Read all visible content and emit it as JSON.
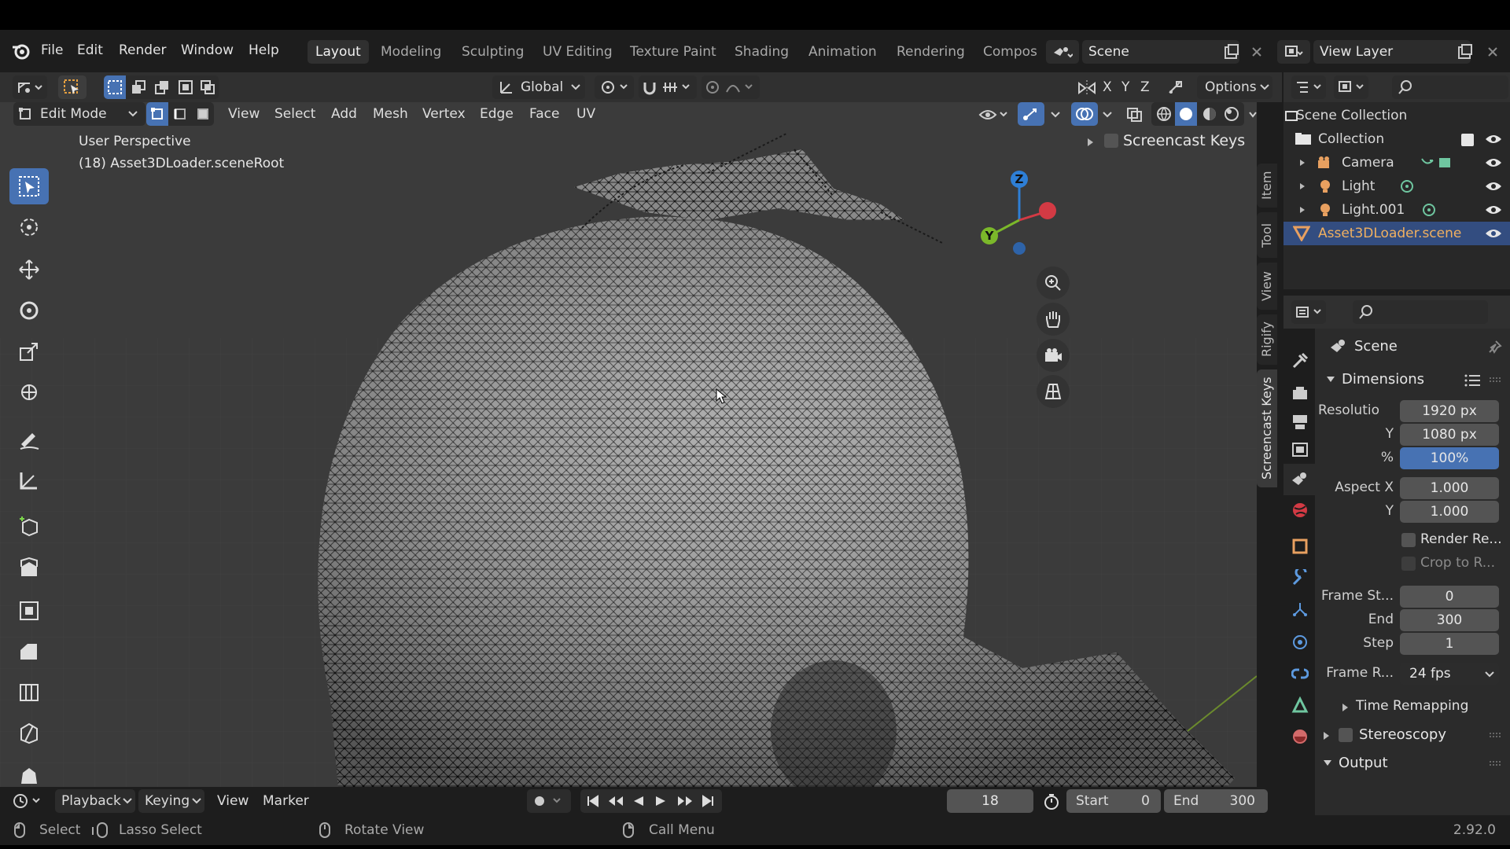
{
  "menu": {
    "file": "File",
    "edit": "Edit",
    "render": "Render",
    "window": "Window",
    "help": "Help"
  },
  "workspaces": [
    "Layout",
    "Modeling",
    "Sculpting",
    "UV Editing",
    "Texture Paint",
    "Shading",
    "Animation",
    "Rendering",
    "Compos"
  ],
  "scene_field": "Scene",
  "view_layer_field": "View Layer",
  "toolbar": {
    "orientation": "Global",
    "axis_x": "X",
    "axis_y": "Y",
    "axis_z": "Z",
    "options": "Options"
  },
  "viewport_header": {
    "mode": "Edit Mode",
    "menus": [
      "View",
      "Select",
      "Add",
      "Mesh",
      "Vertex",
      "Edge",
      "Face",
      "UV"
    ]
  },
  "overlay_text": {
    "perspective": "User Perspective",
    "object": "(18) Asset3DLoader.sceneRoot"
  },
  "screencast_panel": {
    "label": "Screencast Keys"
  },
  "side_tabs": [
    "Item",
    "Tool",
    "View",
    "Rigify",
    "Screencast Keys"
  ],
  "gizmo": {
    "z": "Z",
    "y": "Y",
    "x": "X"
  },
  "outliner": {
    "title": "Scene Collection",
    "items": [
      {
        "label": "Collection"
      },
      {
        "label": "Camera"
      },
      {
        "label": "Light"
      },
      {
        "label": "Light.001"
      },
      {
        "label": "Asset3DLoader.scene"
      }
    ]
  },
  "properties": {
    "context": "Scene",
    "dimensions_title": "Dimensions",
    "resolution_label": "Resolutio",
    "res_x": "1920 px",
    "y_label": "Y",
    "res_y": "1080 px",
    "pct_label": "%",
    "res_pct": "100%",
    "aspect_x_label": "Aspect X",
    "aspect_x": "1.000",
    "aspect_y_label": "Y",
    "aspect_y": "1.000",
    "render_region": "Render Re...",
    "crop": "Crop to R...",
    "frame_start_label": "Frame St...",
    "frame_start": "0",
    "end_label": "End",
    "end": "300",
    "step_label": "Step",
    "step": "1",
    "frame_rate_label": "Frame R...",
    "frame_rate": "24 fps",
    "time_remapping": "Time Remapping",
    "stereoscopy": "Stereoscopy",
    "output": "Output"
  },
  "timeline": {
    "playback": "Playback",
    "keying": "Keying",
    "view": "View",
    "marker": "Marker",
    "current_frame": "18",
    "start_label": "Start",
    "start": "0",
    "end_label": "End",
    "end": "300"
  },
  "status": {
    "select": "Select",
    "lasso": "Lasso Select",
    "rotate": "Rotate View",
    "call_menu": "Call Menu",
    "version": "2.92.0"
  },
  "colors": {
    "accent": "#4772b3",
    "selected_row": "#334d80",
    "header": "#1d1d1d",
    "viewport": "#3b3b3b"
  }
}
